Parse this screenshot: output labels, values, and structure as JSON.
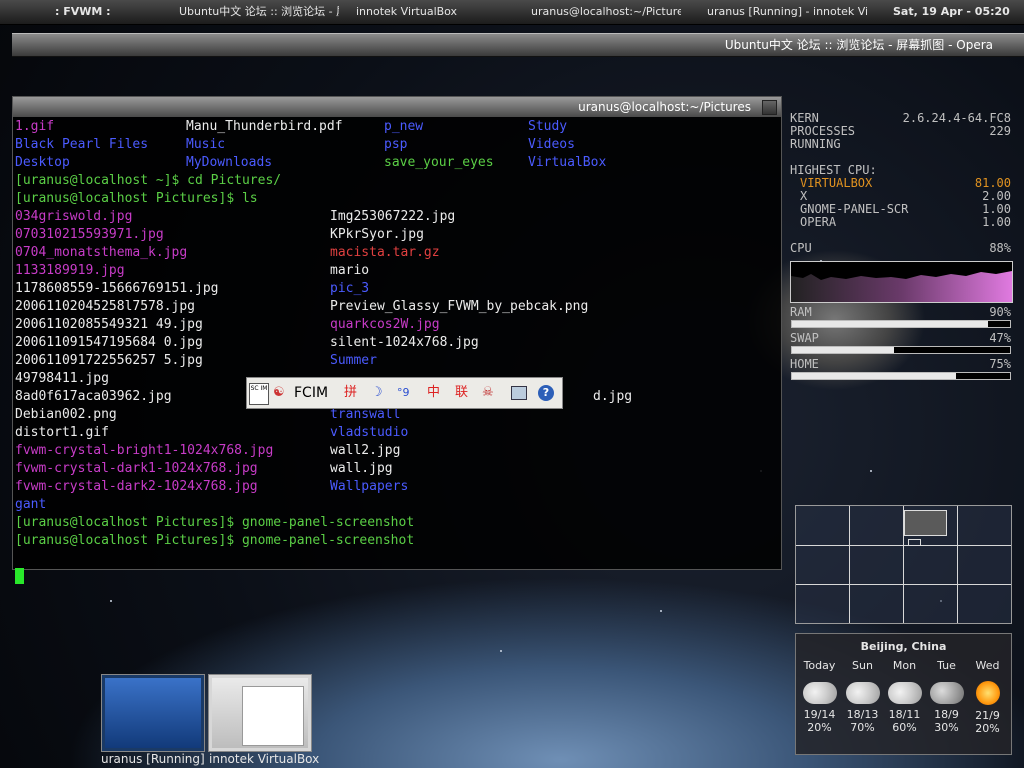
{
  "top_panel": {
    "menu": ": FVWM :",
    "tasks": [
      "Ubuntu中文 论坛 :: 浏览论坛 - 屏幕",
      "innotek VirtualBox",
      "uranus@localhost:~/Pictures",
      "uranus [Running] - innotek Virtu"
    ],
    "clock": "Sat, 19 Apr - 05:20"
  },
  "opera_window": {
    "title": "Ubuntu中文 论坛 :: 浏览论坛 - 屏幕抓图 - Opera"
  },
  "terminal": {
    "title": "uranus@localhost:~/Pictures",
    "home_listing": [
      [
        "1.gif",
        "Manu_Thunderbird.pdf",
        "p_new",
        "Study"
      ],
      [
        "Black Pearl Files",
        "Music",
        "psp",
        "Videos"
      ],
      [
        "Desktop",
        "MyDownloads",
        "save_your_eyes",
        "VirtualBox"
      ]
    ],
    "commands": [
      "[uranus@localhost ~]$ cd Pictures/",
      "[uranus@localhost Pictures]$ ls"
    ],
    "pictures_listing": [
      [
        "034griswold.jpg",
        "Img253067222.jpg"
      ],
      [
        "070310215593971.jpg",
        "KPkrSyor.jpg"
      ],
      [
        "0704_monatsthema_k.jpg",
        "macista.tar.gz"
      ],
      [
        "1133189919.jpg",
        "mario"
      ],
      [
        "1178608559-15666769151.jpg",
        "pic_3"
      ],
      [
        "20061102045258l7578.jpg",
        "Preview_Glassy_FVWM_by_pebcak.png"
      ],
      [
        "20061102085549321 49.jpg",
        "quarkcos2W.jpg"
      ],
      [
        "200611091547195684 0.jpg",
        "silent-1024x768.jpg"
      ],
      [
        "200611091722556257 5.jpg",
        "Summer"
      ],
      [
        "49798411.jpg",
        ""
      ],
      [
        "8ad0f617aca03962.jpg",
        "d.jpg"
      ],
      [
        "Debian002.png",
        "transwall"
      ],
      [
        "distort1.gif",
        "vladstudio"
      ],
      [
        "fvwm-crystal-bright1-1024x768.jpg",
        "wall2.jpg"
      ],
      [
        "fvwm-crystal-dark1-1024x768.jpg",
        "wall.jpg"
      ],
      [
        "fvwm-crystal-dark2-1024x768.jpg",
        "Wallpapers"
      ],
      [
        "gant",
        ""
      ]
    ],
    "final_commands": [
      "[uranus@localhost Pictures]$ gnome-panel-screenshot",
      "[uranus@localhost Pictures]$ gnome-panel-screenshot"
    ],
    "colors": {
      "prompt": "#5bcf46",
      "dir": "#4b5bff",
      "image": "#c83cc8",
      "archive": "#e04040",
      "file": "#ececec"
    }
  },
  "fcim": {
    "logo": "SC IM",
    "name": "FCIM",
    "pin": "拼",
    "moon": "☽",
    "punct": "°9",
    "zh": "中",
    "lian": "联",
    "skull": "☠",
    "help": "?"
  },
  "sysmon": {
    "kern_label": "KERN",
    "kern_value": "2.6.24.4-64.FC8",
    "processes_label": "PROCESSES",
    "processes_value": "229",
    "running_label": "RUNNING",
    "running_value": "",
    "highest_cpu_label": "HIGHEST CPU:",
    "processes": [
      {
        "name": "VIRTUALBOX",
        "value": "81.00"
      },
      {
        "name": "X",
        "value": "2.00"
      },
      {
        "name": "GNOME-PANEL-SCR",
        "value": "1.00"
      },
      {
        "name": "OPERA",
        "value": "1.00"
      }
    ],
    "cpu_label": "CPU",
    "cpu_value": "88%",
    "ram_label": "RAM",
    "ram_value": "90%",
    "swap_label": "SWAP",
    "swap_value": "47%",
    "home_label": "HOME",
    "home_value": "75%",
    "bars": {
      "ram": 0.9,
      "swap": 0.47,
      "home": 0.75
    },
    "highlight_color": "#e09220"
  },
  "weather": {
    "location": "Beijing, China",
    "days": [
      {
        "name": "Today",
        "icon": "cloud-icon",
        "temp": "19/14",
        "precip": "20%"
      },
      {
        "name": "Sun",
        "icon": "cloud-icon",
        "temp": "18/13",
        "precip": "70%"
      },
      {
        "name": "Mon",
        "icon": "cloud-icon",
        "temp": "18/11",
        "precip": "60%"
      },
      {
        "name": "Tue",
        "icon": "rain-cloud-icon",
        "temp": "18/9",
        "precip": "30%"
      },
      {
        "name": "Wed",
        "icon": "sun-icon",
        "temp": "21/9",
        "precip": "20%"
      }
    ]
  },
  "thumbnails": [
    {
      "label": "uranus [Running]"
    },
    {
      "label": "innotek VirtualBox"
    }
  ]
}
